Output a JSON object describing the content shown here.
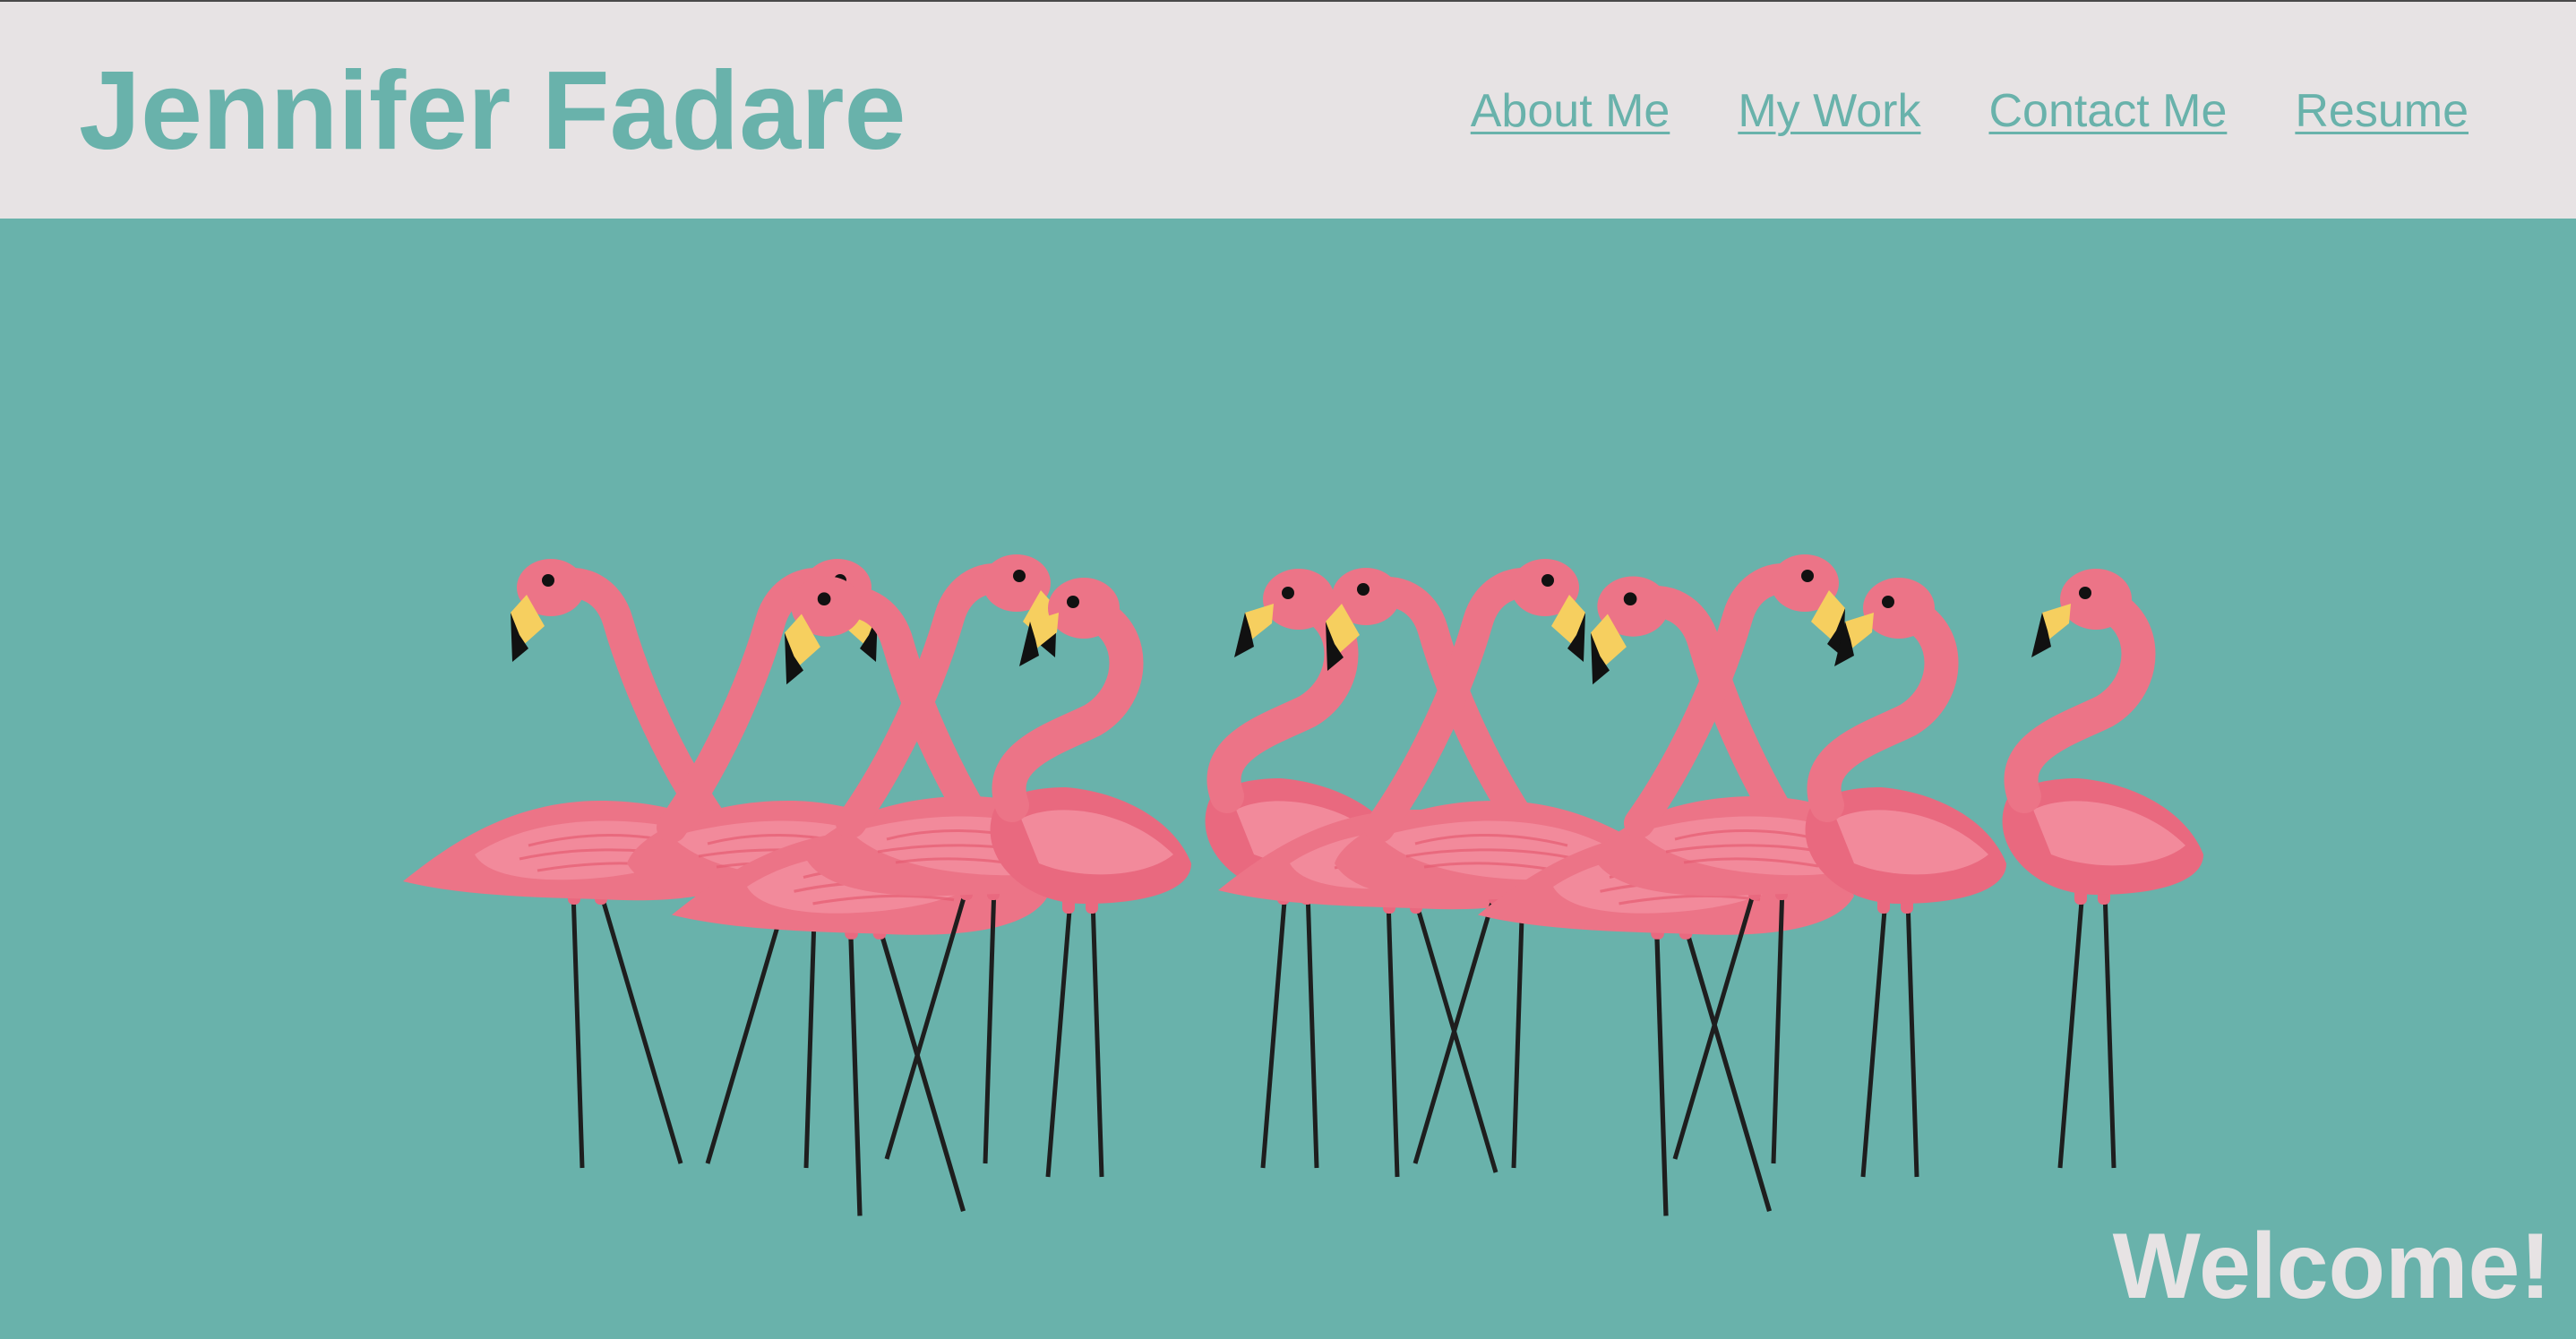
{
  "header": {
    "title": "Jennifer Fadare",
    "nav": [
      {
        "label": "About Me"
      },
      {
        "label": "My Work"
      },
      {
        "label": "Contact Me"
      },
      {
        "label": "Resume"
      }
    ]
  },
  "hero": {
    "image_icon": "flamingo-flock-illustration",
    "welcome": "Welcome!"
  },
  "colors": {
    "accent": "#69b2ab",
    "header_bg": "#e7e3e4",
    "flamingo_pink": "#e9697f",
    "flamingo_light": "#f28a9b",
    "beak_yellow": "#f6cf5f",
    "beak_tip": "#111111"
  }
}
